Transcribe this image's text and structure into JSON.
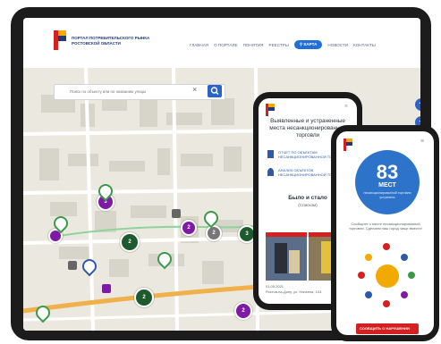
{
  "header": {
    "logo_text": "ПОРТАЛ ПОТРЕБИТЕЛЬСКОГО РЫНКА РОСТОВСКОЙ ОБЛАСТИ",
    "nav": [
      "ГЛАВНАЯ",
      "О ПОРТАЛЕ",
      "ПОНЯТИЯ",
      "РЕЕСТРЫ",
      "КАРТА",
      "НОВОСТИ",
      "КОНТАКТЫ"
    ],
    "active_nav": "КАРТА"
  },
  "search": {
    "placeholder": "Поиск по объекту или по названию улицы"
  },
  "zoom": {
    "plus": "+",
    "minus": "−"
  },
  "map_markers": [
    "3",
    "2",
    "2",
    "2",
    "3",
    "2",
    "2"
  ],
  "phone1": {
    "title": "Выявленные и устраненные места несанкционированной торговли",
    "link1": "ОТЧЕТ ПО ОБЪЕКТАМ НЕСАНКЦИОНИРОВАННОЙ ТОРГОВЛИ",
    "link2": "АНАЛИЗ ОБЪЕКТОВ НЕСАНКЦИОНИРОВАННОЙ ТОРГОВЛИ",
    "status": "Было и стало",
    "status_sub": "(Списком)",
    "date": "01.05.2021",
    "address": "Ростов-на-Дону, ул. Нансена, 103"
  },
  "phone2": {
    "count": "83",
    "label": "МЕСТ",
    "sub": "несанкционированной торговли устранено",
    "caption": "Сообщите о месте несанкционированной торговли. Сделаем наш город чище вместе!",
    "cta": "СООБЩИТЬ О НАРУШЕНИИ"
  },
  "colors": {
    "accent": "#1f6fd6",
    "marker_green": "#1d5b2e",
    "marker_purple": "#7e1aa6",
    "cta_red": "#d42020"
  }
}
